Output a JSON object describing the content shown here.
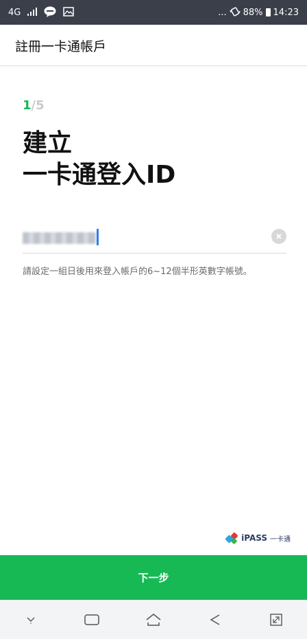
{
  "status_bar": {
    "network": "4G",
    "signal_icon": "signal-bars-icon",
    "line_icon": "line-chat-icon",
    "gallery_icon": "image-icon",
    "more": "...",
    "vibrate_icon": "vibrate-icon",
    "battery_percent": "88%",
    "time": "14:23"
  },
  "header": {
    "title": "註冊一卡通帳戶"
  },
  "step": {
    "current": "1",
    "total": "/5"
  },
  "title": {
    "line1": "建立",
    "line2": "一卡通登入ID"
  },
  "id_field": {
    "value": "",
    "placeholder": ""
  },
  "hint": "請設定一組日後用來登入帳戶的6~12個半形英數字帳號。",
  "logo": {
    "text": "iPASS",
    "sub": "一卡通"
  },
  "next_button": {
    "label": "下一步"
  },
  "colors": {
    "accent": "#17b955",
    "status_bar": "#3a3f4a",
    "header_text": "#111111"
  }
}
